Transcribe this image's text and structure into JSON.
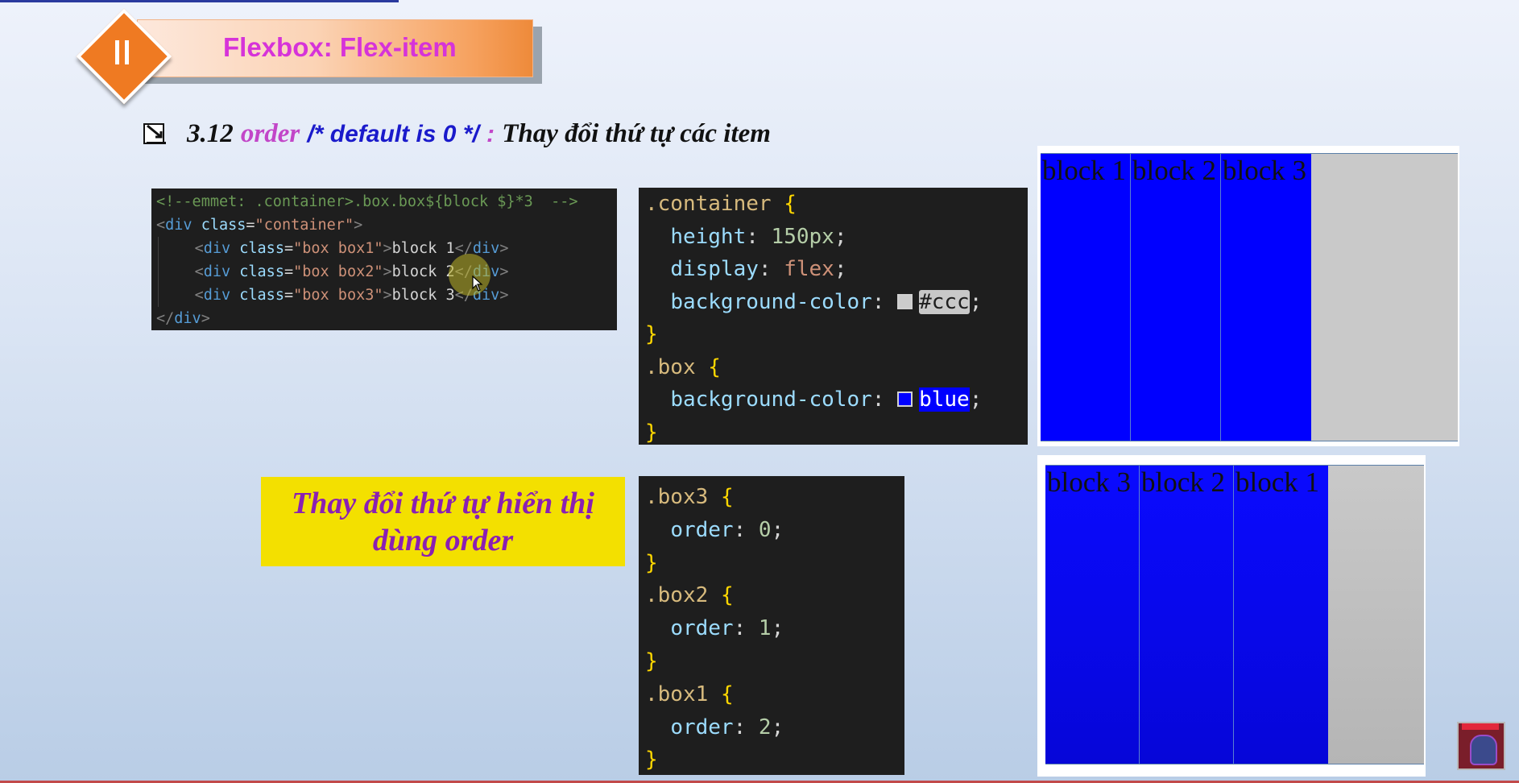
{
  "slide": {
    "title": "Flexbox: Flex-item",
    "heading": {
      "number": "3.12",
      "keyword": "order",
      "comment": "/* default is 0 */",
      "colon": ":",
      "description": "Thay đổi thứ tự các item"
    },
    "callout_lines": [
      "Thay đổi thứ tự hiển thị",
      "dùng order"
    ]
  },
  "html_code": {
    "comment": "<!--emmet: .container>.box.box${block $}*3  -->",
    "container_class": "container",
    "items": [
      {
        "class": "box box1",
        "text": "block 1"
      },
      {
        "class": "box box2",
        "text": "block 2"
      },
      {
        "class": "box box3",
        "text": "block 3"
      }
    ]
  },
  "css_code": {
    "container_selector": ".container",
    "height_prop": "height",
    "height_val": "150px",
    "display_prop": "display",
    "display_val": "flex",
    "bg_prop": "background-color",
    "bg_val": "#ccc",
    "box_selector": ".box",
    "box_bg_prop": "background-color",
    "box_bg_val": "blue"
  },
  "order_code": [
    {
      "selector": ".box3",
      "prop": "order",
      "value": "0"
    },
    {
      "selector": ".box2",
      "prop": "order",
      "value": "1"
    },
    {
      "selector": ".box1",
      "prop": "order",
      "value": "2"
    }
  ],
  "demo_before": [
    "block 1",
    "block 2",
    "block 3"
  ],
  "demo_after": [
    "block 3",
    "block 2",
    "block 1"
  ],
  "colors": {
    "accent_orange": "#ef7a22",
    "title_magenta": "#d633d9",
    "callout_yellow": "#f3e000",
    "flex_container_gray": "#cccccc",
    "flex_item_blue": "#0000ff"
  },
  "icons": [
    "pause-icon",
    "bullet-checkbox-icon",
    "mouse-pointer-icon",
    "channel-avatar-icon"
  ]
}
